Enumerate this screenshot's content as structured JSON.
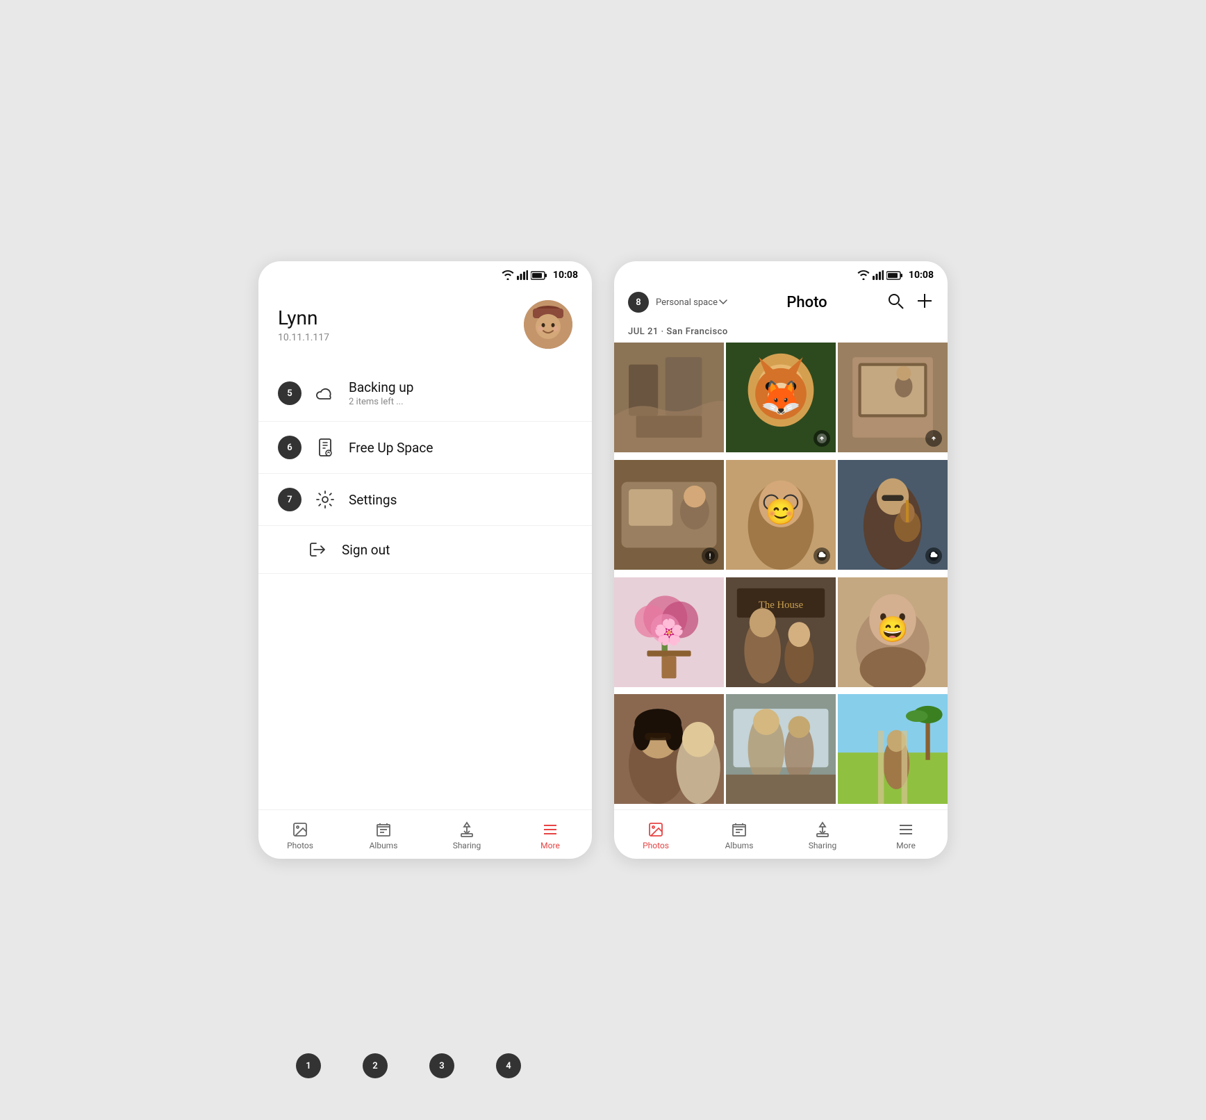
{
  "left_phone": {
    "status_bar": {
      "time": "10:08"
    },
    "profile": {
      "name": "Lynn",
      "ip": "10.11.1.117",
      "avatar_emoji": "👩"
    },
    "menu_items": [
      {
        "id": "backing-up",
        "badge": "5",
        "title": "Backing up",
        "subtitle": "2 items left ...",
        "icon_type": "cloud"
      },
      {
        "id": "free-up-space",
        "badge": "6",
        "title": "Free Up Space",
        "subtitle": "",
        "icon_type": "device"
      },
      {
        "id": "settings",
        "badge": "7",
        "title": "Settings",
        "subtitle": "",
        "icon_type": "settings"
      },
      {
        "id": "sign-out",
        "badge": "",
        "title": "Sign out",
        "subtitle": "",
        "icon_type": "signout"
      }
    ],
    "bottom_nav": [
      {
        "id": "photos",
        "label": "Photos",
        "active": false
      },
      {
        "id": "albums",
        "label": "Albums",
        "active": false
      },
      {
        "id": "sharing",
        "label": "Sharing",
        "active": false
      },
      {
        "id": "more",
        "label": "More",
        "active": true
      }
    ],
    "bottom_circles": [
      "1",
      "2",
      "3",
      "4"
    ]
  },
  "right_phone": {
    "status_bar": {
      "time": "10:08"
    },
    "header": {
      "title": "Photo",
      "badge": "8",
      "space_label": "Personal space",
      "search_label": "search",
      "add_label": "add"
    },
    "date_location": "JUL 21 · San Francisco",
    "bottom_nav": [
      {
        "id": "photos",
        "label": "Photos",
        "active": true
      },
      {
        "id": "albums",
        "label": "Albums",
        "active": false
      },
      {
        "id": "sharing",
        "label": "Sharing",
        "active": false
      },
      {
        "id": "more",
        "label": "More",
        "active": false
      }
    ],
    "photos": [
      {
        "id": 1,
        "class": "photo-1",
        "overlay": null
      },
      {
        "id": 2,
        "class": "photo-2",
        "overlay": "upload"
      },
      {
        "id": 3,
        "class": "photo-3",
        "overlay": "upload"
      },
      {
        "id": 4,
        "class": "photo-4",
        "overlay": "warning"
      },
      {
        "id": 5,
        "class": "photo-5",
        "overlay": "cloud"
      },
      {
        "id": 6,
        "class": "photo-6",
        "overlay": "cloud"
      },
      {
        "id": 7,
        "class": "photo-7",
        "overlay": null
      },
      {
        "id": 8,
        "class": "photo-8",
        "overlay": null
      },
      {
        "id": 9,
        "class": "photo-9",
        "overlay": null
      },
      {
        "id": 10,
        "class": "photo-10",
        "overlay": null
      },
      {
        "id": 11,
        "class": "photo-11",
        "overlay": null
      },
      {
        "id": 12,
        "class": "photo-12",
        "overlay": null
      }
    ]
  }
}
